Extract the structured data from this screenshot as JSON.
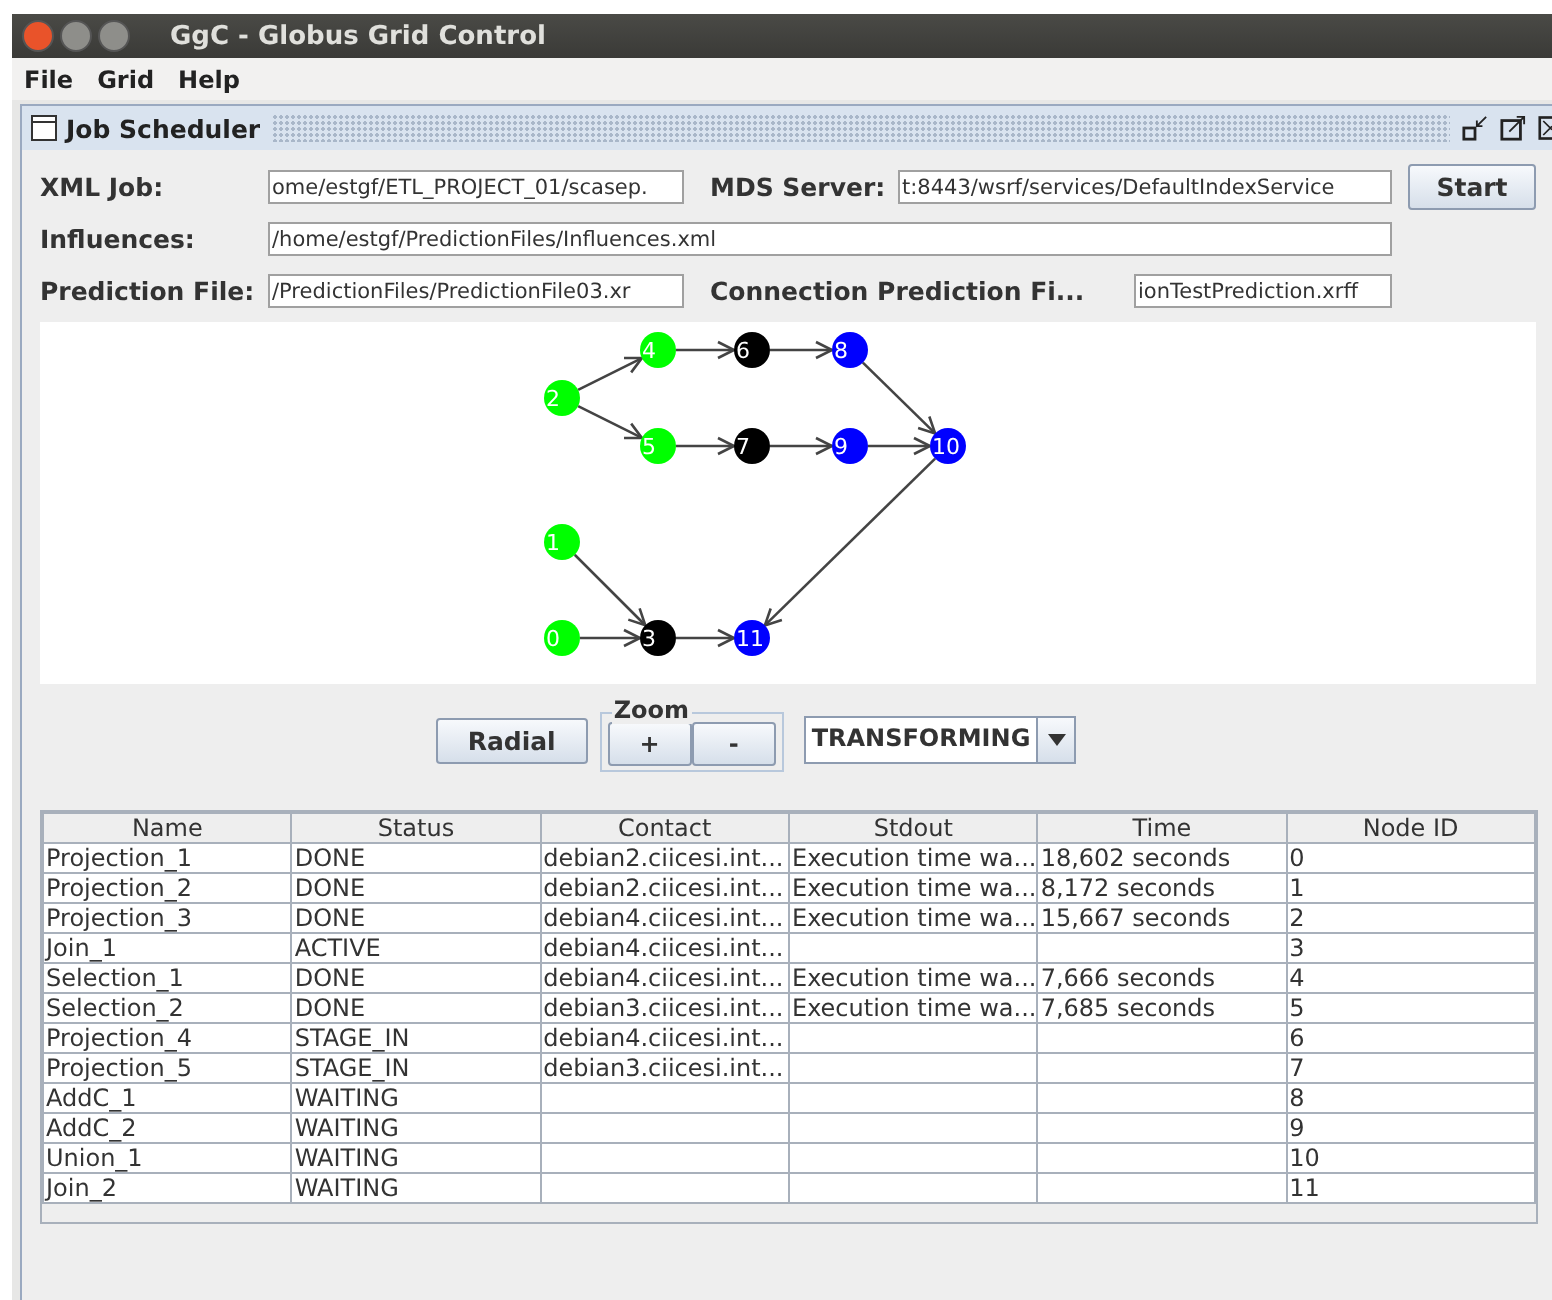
{
  "window": {
    "title": "GgC - Globus Grid Control"
  },
  "menu": [
    "File",
    "Grid",
    "Help"
  ],
  "frame": {
    "title": "Job Scheduler"
  },
  "form": {
    "xml_job": {
      "label": "XML Job:",
      "value": "ome/estgf/ETL_PROJECT_01/scasep."
    },
    "mds_server": {
      "label": "MDS Server:",
      "value": "t:8443/wsrf/services/DefaultIndexService"
    },
    "start_button": "Start",
    "influences": {
      "label": "Influences:",
      "value": "/home/estgf/PredictionFiles/Influences.xml"
    },
    "prediction_file": {
      "label": "Prediction File:",
      "value": "/PredictionFiles/PredictionFile03.xr"
    },
    "connection_prediction": {
      "label": "Connection Prediction Fi...",
      "value": "ionTestPrediction.xrff"
    }
  },
  "graph": {
    "nodes": [
      {
        "label": "2",
        "color": "#00ff00"
      },
      {
        "label": "4",
        "color": "#00ff00"
      },
      {
        "label": "6",
        "color": "#000000"
      },
      {
        "label": "8",
        "color": "#0000ff"
      },
      {
        "label": "5",
        "color": "#00ff00"
      },
      {
        "label": "7",
        "color": "#000000"
      },
      {
        "label": "9",
        "color": "#0000ff"
      },
      {
        "label": "10",
        "color": "#0000ff"
      },
      {
        "label": "1",
        "color": "#00ff00"
      },
      {
        "label": "0",
        "color": "#00ff00"
      },
      {
        "label": "3",
        "color": "#000000"
      },
      {
        "label": "11",
        "color": "#0000ff"
      }
    ]
  },
  "controls": {
    "radial_button": "Radial",
    "zoom": {
      "title": "Zoom",
      "in": "+",
      "out": "-"
    },
    "layout_select": "TRANSFORMING"
  },
  "table": {
    "columns": [
      "Name",
      "Status",
      "Contact",
      "Stdout",
      "Time",
      "Node ID"
    ],
    "rows": [
      {
        "name": "Projection_1",
        "status": "DONE",
        "contact": "debian2.ciicesi.int...",
        "stdout": "Execution time wa...",
        "time": "18,602 seconds",
        "node_id": "0"
      },
      {
        "name": "Projection_2",
        "status": "DONE",
        "contact": "debian2.ciicesi.int...",
        "stdout": "Execution time wa...",
        "time": "8,172 seconds",
        "node_id": "1"
      },
      {
        "name": "Projection_3",
        "status": "DONE",
        "contact": "debian4.ciicesi.int...",
        "stdout": "Execution time wa...",
        "time": "15,667 seconds",
        "node_id": "2"
      },
      {
        "name": "Join_1",
        "status": "ACTIVE",
        "contact": "debian4.ciicesi.int...",
        "node_id": "3"
      },
      {
        "name": "Selection_1",
        "status": "DONE",
        "contact": "debian4.ciicesi.int...",
        "stdout": "Execution time wa...",
        "time": "7,666 seconds",
        "node_id": "4"
      },
      {
        "name": "Selection_2",
        "status": "DONE",
        "contact": "debian3.ciicesi.int...",
        "stdout": "Execution time wa...",
        "time": "7,685 seconds",
        "node_id": "5"
      },
      {
        "name": "Projection_4",
        "status": "STAGE_IN",
        "contact": "debian4.ciicesi.int...",
        "node_id": "6"
      },
      {
        "name": "Projection_5",
        "status": "STAGE_IN",
        "contact": "debian3.ciicesi.int...",
        "node_id": "7"
      },
      {
        "name": "AddC_1",
        "status": "WAITING",
        "node_id": "8"
      },
      {
        "name": "AddC_2",
        "status": "WAITING",
        "node_id": "9"
      },
      {
        "name": "Union_1",
        "status": "WAITING",
        "node_id": "10"
      },
      {
        "name": "Join_2",
        "status": "WAITING",
        "node_id": "11"
      }
    ]
  }
}
